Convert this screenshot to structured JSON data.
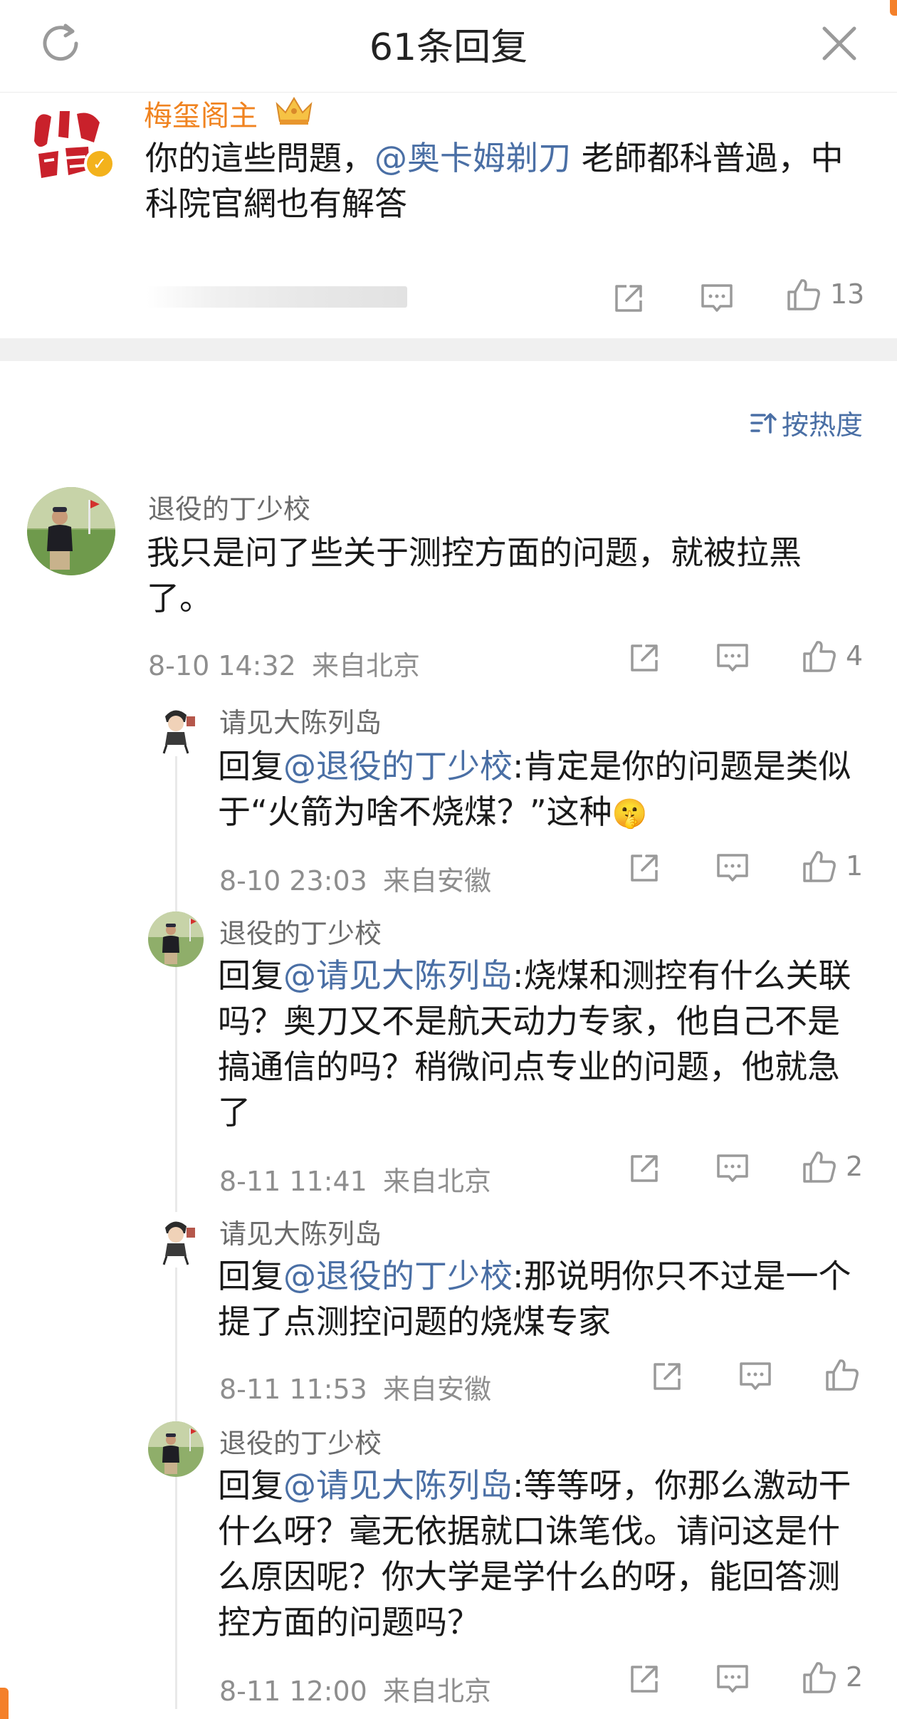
{
  "header": {
    "title": "61条回复",
    "refresh_icon": "refresh-icon",
    "close_icon": "close-icon"
  },
  "original": {
    "author": "梅玺阁主",
    "text_prefix": "你的這些問題，",
    "mention": "@奥卡姆剃刀",
    "text_suffix": " 老師都科普過，中科院官網也有解答",
    "like_count": "13"
  },
  "sort": {
    "label": "按热度"
  },
  "comment": {
    "author": "退役的丁少校",
    "text": "我只是问了些关于测控方面的问题，就被拉黑了。",
    "time": "8-10 14:32",
    "location": "来自北京",
    "like_count": "4"
  },
  "replies": [
    {
      "author": "请见大陈列岛",
      "prefix": "回复",
      "mention": "@退役的丁少校",
      "text": ":肯定是你的问题是类似于“火箭为啥不烧煤？”这种",
      "emoji": "🤫",
      "time": "8-10 23:03",
      "location": "来自安徽",
      "like_count": "1"
    },
    {
      "author": "退役的丁少校",
      "prefix": "回复",
      "mention": "@请见大陈列岛",
      "text": ":烧煤和测控有什么关联吗？奥刀又不是航天动力专家，他自己不是搞通信的吗？稍微问点专业的问题，他就急了",
      "time": "8-11 11:41",
      "location": "来自北京",
      "like_count": "2"
    },
    {
      "author": "请见大陈列岛",
      "prefix": "回复",
      "mention": "@退役的丁少校",
      "text": ":那说明你只不过是一个提了点测控问题的烧煤专家",
      "time": "8-11 11:53",
      "location": "来自安徽",
      "like_count": ""
    },
    {
      "author": "退役的丁少校",
      "prefix": "回复",
      "mention": "@请见大陈列岛",
      "text": ":等等呀，你那么激动干什么呀？毫无依据就口诛笔伐。请问这是什么原因呢？你大学是学什么的呀，能回答测控方面的问题吗？",
      "time": "8-11 12:00",
      "location": "来自北京",
      "like_count": "2"
    }
  ],
  "colors": {
    "accent_orange": "#f08320",
    "link_blue": "#4a6fa5",
    "meta_gray": "#8e8e8e"
  },
  "icons": [
    "share-icon",
    "comment-icon",
    "like-icon",
    "crown-icon",
    "verified-icon",
    "sort-icon"
  ]
}
